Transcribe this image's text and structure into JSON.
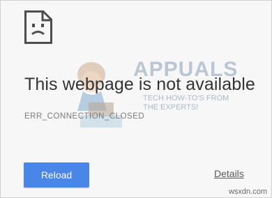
{
  "error_page": {
    "title": "This webpage is not available",
    "error_code": "ERR_CONNECTION_CLOSED",
    "reload_label": "Reload",
    "details_label": "Details",
    "icon": "sad-page-icon"
  },
  "watermark": {
    "brand": "APPUALS",
    "tagline_line1": "TECH HOW-TO'S FROM",
    "tagline_line2": "THE EXPERTS!",
    "corner_text": "wsxdn.com"
  },
  "colors": {
    "background": "#f7f7f7",
    "title_text": "#333333",
    "error_code_text": "#7a7a7a",
    "reload_button": "#4a86e8",
    "reload_text": "#ffffff",
    "details_text": "#5a5a5a"
  }
}
